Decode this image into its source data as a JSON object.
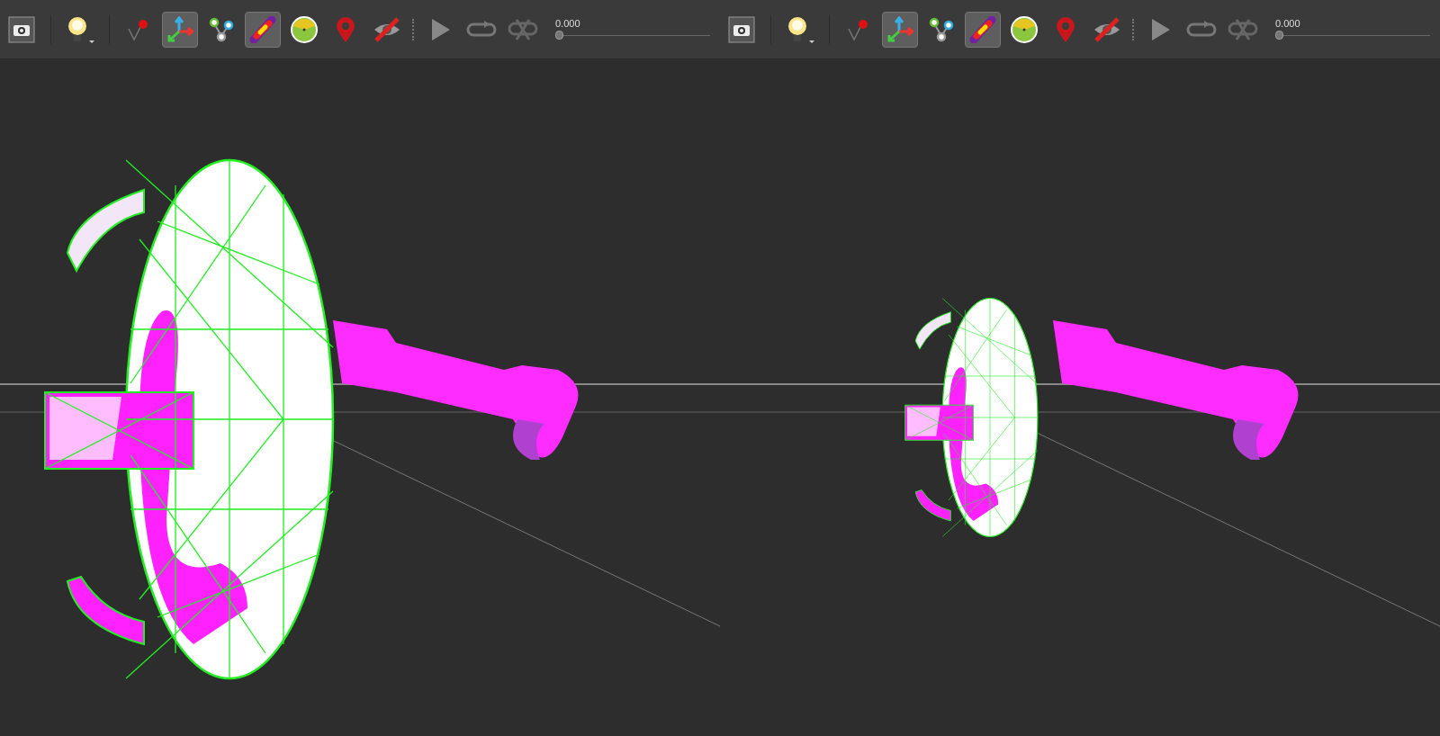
{
  "panels": [
    {
      "kind": "close",
      "toolbar": {
        "groups": [
          [
            {
              "kind": "camera",
              "selected": false
            }
          ],
          [
            {
              "kind": "light",
              "selected": false
            }
          ],
          [
            {
              "kind": "pin",
              "selected": false
            },
            {
              "kind": "axes",
              "selected": true
            },
            {
              "kind": "nodes",
              "selected": false
            },
            {
              "kind": "heatmap",
              "selected": true
            },
            {
              "kind": "gauge",
              "selected": false
            },
            {
              "kind": "marker",
              "selected": false
            },
            {
              "kind": "hide",
              "selected": false
            }
          ],
          [
            {
              "kind": "play",
              "selected": false
            },
            {
              "kind": "loop",
              "selected": false
            },
            {
              "kind": "sync",
              "selected": false
            }
          ]
        ],
        "time": "0.000",
        "timeline": {
          "level": 0
        }
      }
    },
    {
      "kind": "far",
      "toolbar": {
        "groups": [
          [
            {
              "kind": "camera",
              "selected": false
            }
          ],
          [
            {
              "kind": "light",
              "selected": false
            }
          ],
          [
            {
              "kind": "pin",
              "selected": false
            },
            {
              "kind": "axes",
              "selected": true
            },
            {
              "kind": "nodes",
              "selected": false
            },
            {
              "kind": "heatmap",
              "selected": true
            },
            {
              "kind": "gauge",
              "selected": false
            },
            {
              "kind": "marker",
              "selected": false
            },
            {
              "kind": "hide",
              "selected": false
            }
          ],
          [
            {
              "kind": "play",
              "selected": false
            },
            {
              "kind": "loop",
              "selected": false
            },
            {
              "kind": "sync",
              "selected": false
            }
          ]
        ],
        "time": "0.000",
        "timeline": {
          "level": 0
        }
      }
    }
  ]
}
